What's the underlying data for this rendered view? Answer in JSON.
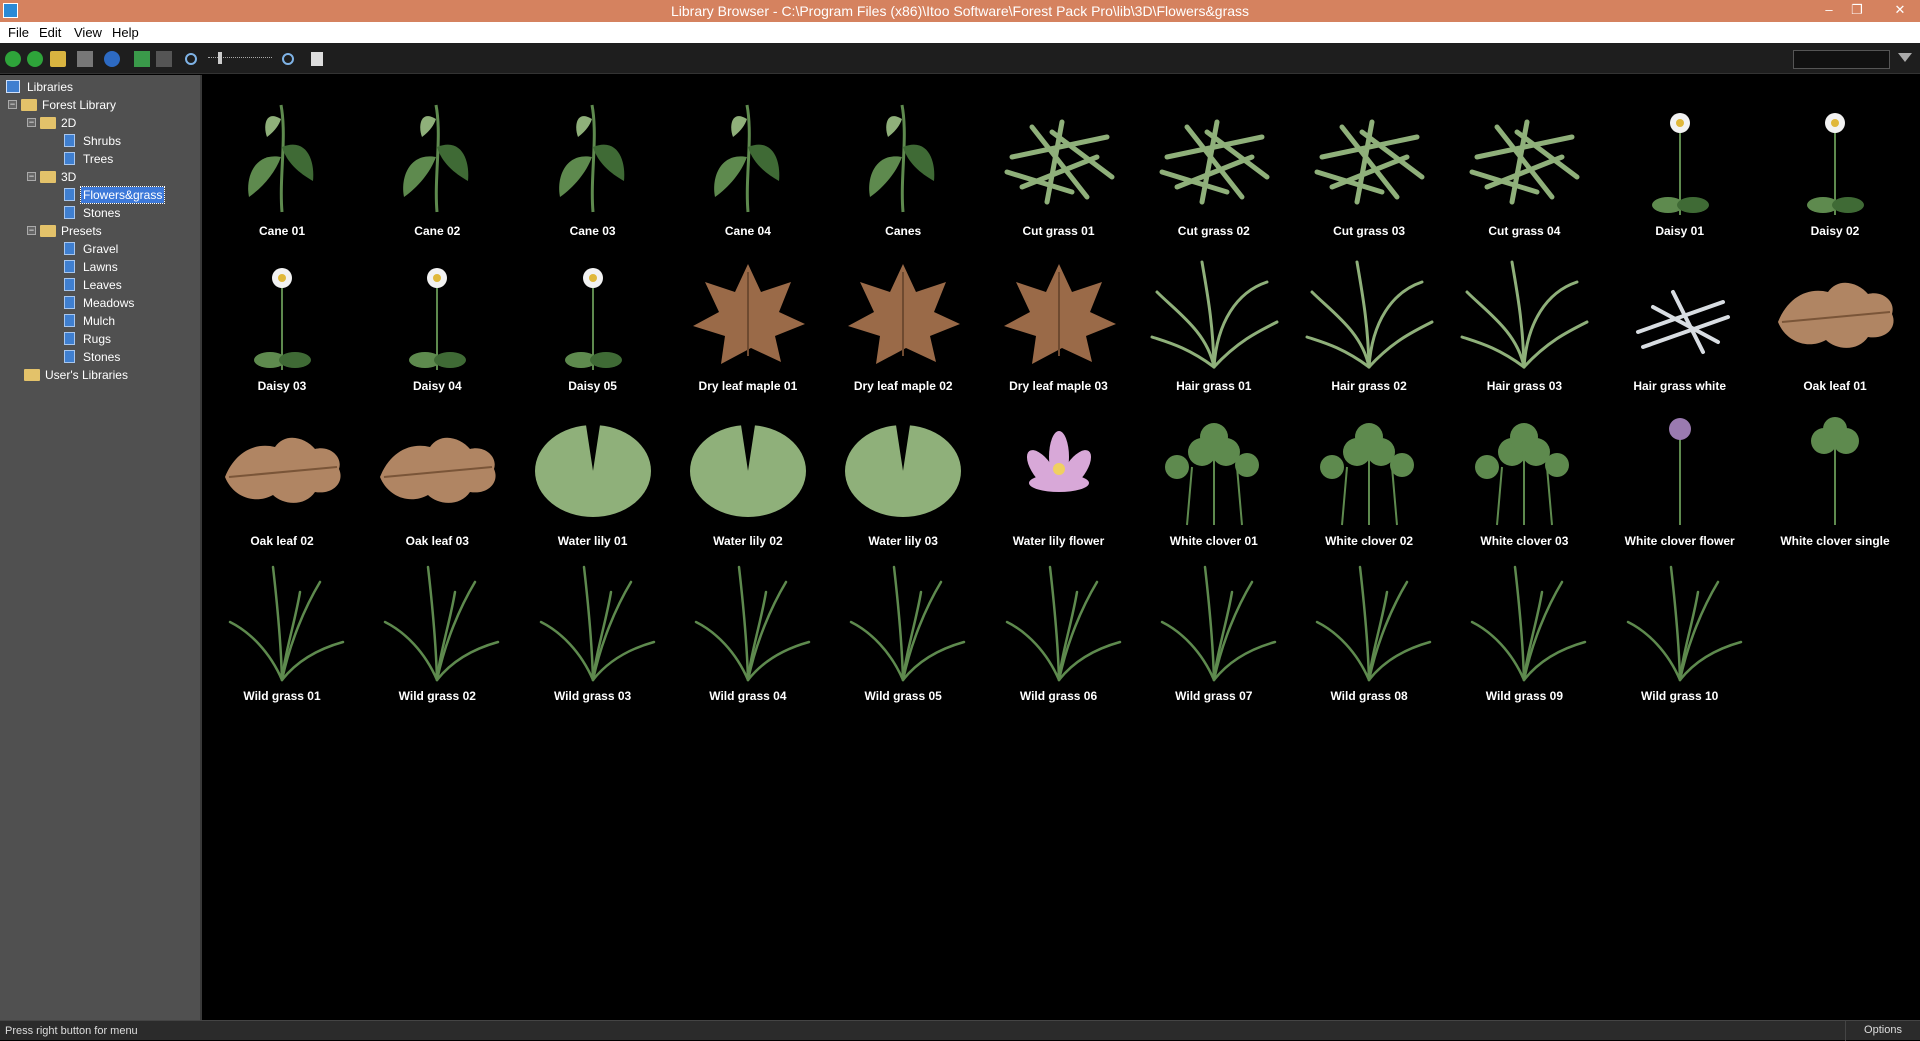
{
  "window": {
    "title": "Library Browser - C:\\Program Files (x86)\\Itoo Software\\Forest Pack Pro\\lib\\3D\\Flowers&grass",
    "minimize": "‒",
    "restore": "❐",
    "close": "✕"
  },
  "menu": {
    "file": "File",
    "edit": "Edit",
    "view": "View",
    "help": "Help"
  },
  "tree": {
    "root": "Libraries",
    "forest": "Forest Library",
    "f2d": "2D",
    "shrubs": "Shrubs",
    "trees": "Trees",
    "f3d": "3D",
    "flowers": "Flowers&grass",
    "stones3d": "Stones",
    "presets": "Presets",
    "gravel": "Gravel",
    "lawns": "Lawns",
    "leaves": "Leaves",
    "meadows": "Meadows",
    "mulch": "Mulch",
    "rugs": "Rugs",
    "stonesp": "Stones",
    "user": "User's Libraries"
  },
  "items": [
    {
      "name": "Cane 01",
      "kind": "stem"
    },
    {
      "name": "Cane 02",
      "kind": "stem"
    },
    {
      "name": "Cane 03",
      "kind": "stem"
    },
    {
      "name": "Cane 04",
      "kind": "stem"
    },
    {
      "name": "Canes",
      "kind": "stem"
    },
    {
      "name": "Cut grass 01",
      "kind": "cut"
    },
    {
      "name": "Cut grass 02",
      "kind": "cut"
    },
    {
      "name": "Cut grass 03",
      "kind": "cut"
    },
    {
      "name": "Cut grass 04",
      "kind": "cut"
    },
    {
      "name": "Daisy 01",
      "kind": "daisy"
    },
    {
      "name": "Daisy 02",
      "kind": "daisy"
    },
    {
      "name": "Daisy 03",
      "kind": "daisy"
    },
    {
      "name": "Daisy 04",
      "kind": "daisy"
    },
    {
      "name": "Daisy 05",
      "kind": "daisy"
    },
    {
      "name": "Dry leaf maple 01",
      "kind": "maple"
    },
    {
      "name": "Dry leaf maple 02",
      "kind": "maple"
    },
    {
      "name": "Dry leaf maple 03",
      "kind": "maple"
    },
    {
      "name": "Hair grass 01",
      "kind": "hair"
    },
    {
      "name": "Hair grass 02",
      "kind": "hair"
    },
    {
      "name": "Hair grass 03",
      "kind": "hair"
    },
    {
      "name": "Hair grass white",
      "kind": "hairwhite"
    },
    {
      "name": "Oak leaf 01",
      "kind": "oak"
    },
    {
      "name": "Oak leaf 02",
      "kind": "oak"
    },
    {
      "name": "Oak leaf 03",
      "kind": "oak"
    },
    {
      "name": "Water lily 01",
      "kind": "lilypad"
    },
    {
      "name": "Water lily 02",
      "kind": "lilypad"
    },
    {
      "name": "Water lily 03",
      "kind": "lilypad"
    },
    {
      "name": "Water lily flower",
      "kind": "lilyflower"
    },
    {
      "name": "White clover 01",
      "kind": "clover"
    },
    {
      "name": "White clover 02",
      "kind": "clover"
    },
    {
      "name": "White clover 03",
      "kind": "clover"
    },
    {
      "name": "White clover flower",
      "kind": "cloverflower"
    },
    {
      "name": "White clover single",
      "kind": "cloversingle"
    },
    {
      "name": "Wild grass 01",
      "kind": "wild"
    },
    {
      "name": "Wild grass 02",
      "kind": "wild"
    },
    {
      "name": "Wild grass 03",
      "kind": "wild"
    },
    {
      "name": "Wild grass 04",
      "kind": "wild"
    },
    {
      "name": "Wild grass 05",
      "kind": "wild"
    },
    {
      "name": "Wild grass 06",
      "kind": "wild"
    },
    {
      "name": "Wild grass 07",
      "kind": "wild"
    },
    {
      "name": "Wild grass 08",
      "kind": "wild"
    },
    {
      "name": "Wild grass 09",
      "kind": "wild"
    },
    {
      "name": "Wild grass 10",
      "kind": "wild"
    }
  ],
  "status": {
    "message": "Press right button for menu",
    "options": "Options"
  },
  "colors": {
    "titlebar": "#d5825f",
    "selection": "#3d79d9",
    "leaf_green": "#5e8a4e",
    "dry_leaf": "#9a6a48",
    "sidebar": "#505050"
  }
}
